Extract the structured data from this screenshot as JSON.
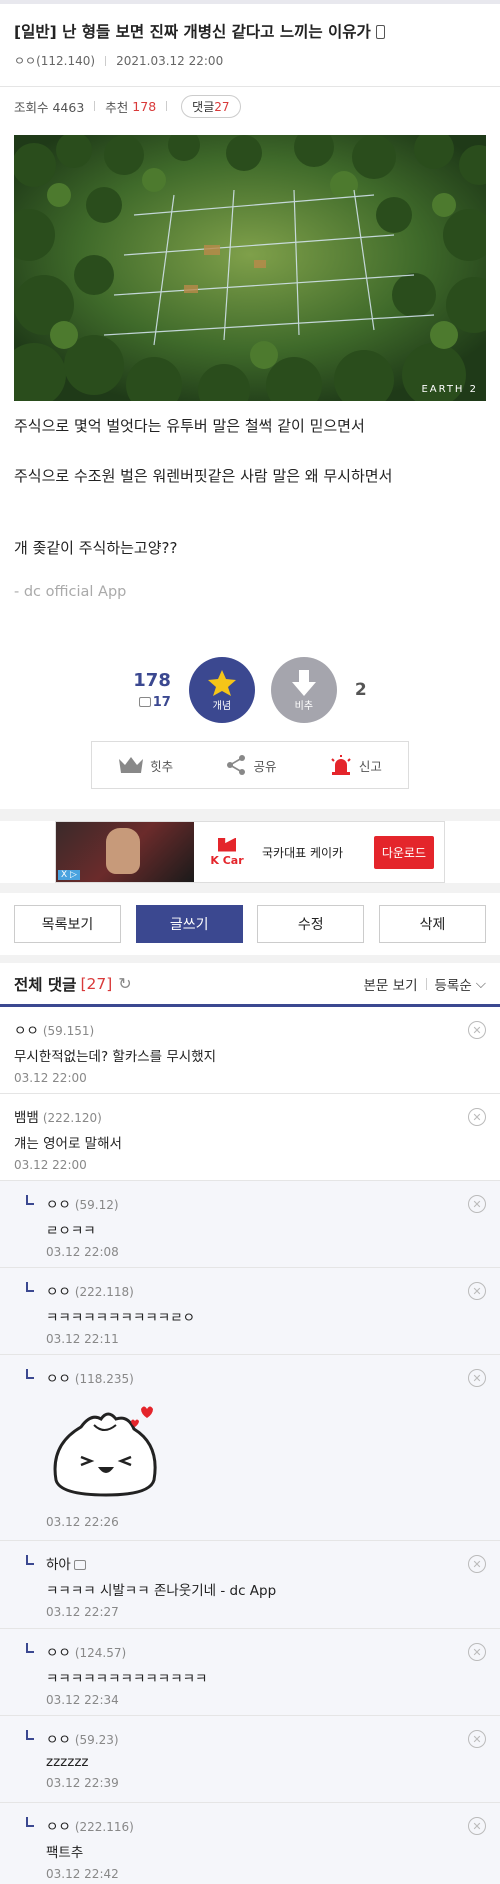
{
  "post": {
    "title": "[일반] 난 형들 보면 진짜 개병신 같다고 느끼는 이유가",
    "author": "ㅇㅇ",
    "author_ip": "(112.140)",
    "datetime": "2021.03.12 22:00",
    "views_label": "조회수 4463",
    "recommend_label": "추천",
    "recommend_count": "178",
    "comment_label": "댓글",
    "comment_count": "27",
    "image_logo": "EARTH 2",
    "paragraphs": [
      "주식으로 몇억 벌엇다는 유투버 말은 철썩 같이 믿으면서",
      "주식으로 수조원 벌은 워렌버핏같은 사람 말은 왜 무시하면서",
      "개 좆같이 주식하는고양??",
      "- dc official App"
    ]
  },
  "vote": {
    "up_count": "178",
    "fix_count": "17",
    "up_label": "개념",
    "down_label": "비추",
    "down_count": "2"
  },
  "actions": {
    "hit": "힛추",
    "share": "공유",
    "report": "신고"
  },
  "ad": {
    "brand": "K Car",
    "text": "국카대표 케이카",
    "button": "다운로드",
    "tag": "X ▷"
  },
  "buttons": {
    "list": "목록보기",
    "write": "글쓰기",
    "edit": "수정",
    "delete": "삭제"
  },
  "comments_header": {
    "title": "전체 댓글",
    "count": "[27]",
    "view_body": "본문 보기",
    "sort": "등록순"
  },
  "comments": [
    {
      "name": "ㅇㅇ",
      "ip": "(59.151)",
      "text": "무시한적없는데? 할카스를 무시했지",
      "date": "03.12 22:00",
      "reply": false
    },
    {
      "name": "뱀뱀",
      "ip": "(222.120)",
      "text": "걔는 영어로 말해서",
      "date": "03.12 22:00",
      "reply": false
    },
    {
      "name": "ㅇㅇ",
      "ip": "(59.12)",
      "text": "ㄹㅇㅋㅋ",
      "date": "03.12 22:08",
      "reply": true
    },
    {
      "name": "ㅇㅇ",
      "ip": "(222.118)",
      "text": "ㅋㅋㅋㅋㅋㅋㅋㅋㅋㅋㄹㅇ",
      "date": "03.12 22:11",
      "reply": true
    },
    {
      "name": "ㅇㅇ",
      "ip": "(118.235)",
      "text": "",
      "date": "03.12 22:26",
      "reply": true
    },
    {
      "name": "하아",
      "ip": "",
      "text": "ㅋㅋㅋㅋ 시발ㅋㅋ 존나웃기네 - dc App",
      "date": "03.12 22:27",
      "reply": true
    },
    {
      "name": "ㅇㅇ",
      "ip": "(124.57)",
      "text": "ㅋㅋㅋㅋㅋㅋㅋㅋㅋㅋㅋㅋㅋ",
      "date": "03.12 22:34",
      "reply": true
    },
    {
      "name": "ㅇㅇ",
      "ip": "(59.23)",
      "text": "zzzzzz",
      "date": "03.12 22:39",
      "reply": true
    },
    {
      "name": "ㅇㅇ",
      "ip": "(222.116)",
      "text": "팩트추",
      "date": "03.12 22:42",
      "reply": true
    }
  ],
  "colors": {
    "accent": "#3b4890",
    "red": "#d93a3a",
    "downvote": "#a5a5ad"
  },
  "icons": {
    "phone": "mobile-icon",
    "refresh": "refresh-icon",
    "delete": "circle-x-icon",
    "crown": "crown-icon",
    "share": "share-icon",
    "siren": "siren-icon"
  }
}
